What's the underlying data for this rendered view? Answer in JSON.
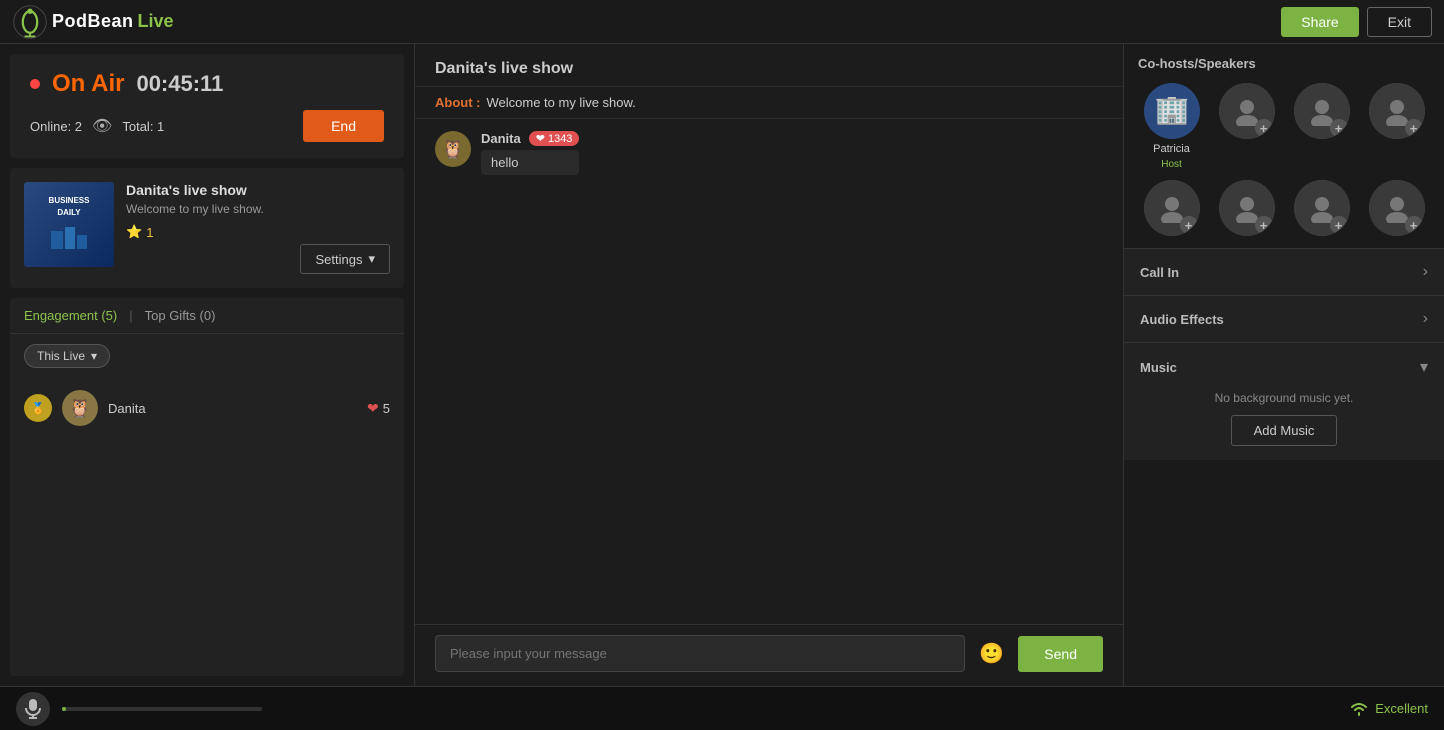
{
  "app": {
    "title": "PodBean Live",
    "logo_text": "PodBean",
    "logo_live": "Live"
  },
  "topbar": {
    "share_label": "Share",
    "exit_label": "Exit"
  },
  "on_air": {
    "label": "On Air",
    "timer": "00:45:11",
    "online_label": "Online: 2",
    "total_label": "Total: 1",
    "end_label": "End"
  },
  "show": {
    "title": "Danita's live show",
    "description": "Welcome to my live show.",
    "rating": "1",
    "settings_label": "Settings",
    "thumbnail_line1": "BUSINESS",
    "thumbnail_line2": "DAILY"
  },
  "engagement": {
    "tab1_label": "Engagement (5)",
    "tab2_label": "Top Gifts (0)",
    "filter_label": "This Live",
    "user_name": "Danita",
    "user_hearts": "5"
  },
  "chat": {
    "show_title": "Danita's live show",
    "about_label": "About :",
    "about_text": "Welcome to my live show.",
    "message_username": "Danita",
    "message_hearts": "1343",
    "message_text": "hello",
    "input_placeholder": "Please input your message",
    "send_label": "Send"
  },
  "right_panel": {
    "cohosts_title": "Co-hosts/Speakers",
    "host_name": "Patricia",
    "host_role": "Host",
    "call_in_label": "Call In",
    "audio_effects_label": "Audio Effects",
    "music_label": "Music",
    "music_empty": "No background music yet.",
    "add_music_label": "Add Music"
  },
  "bottom_bar": {
    "signal_label": "Excellent"
  }
}
